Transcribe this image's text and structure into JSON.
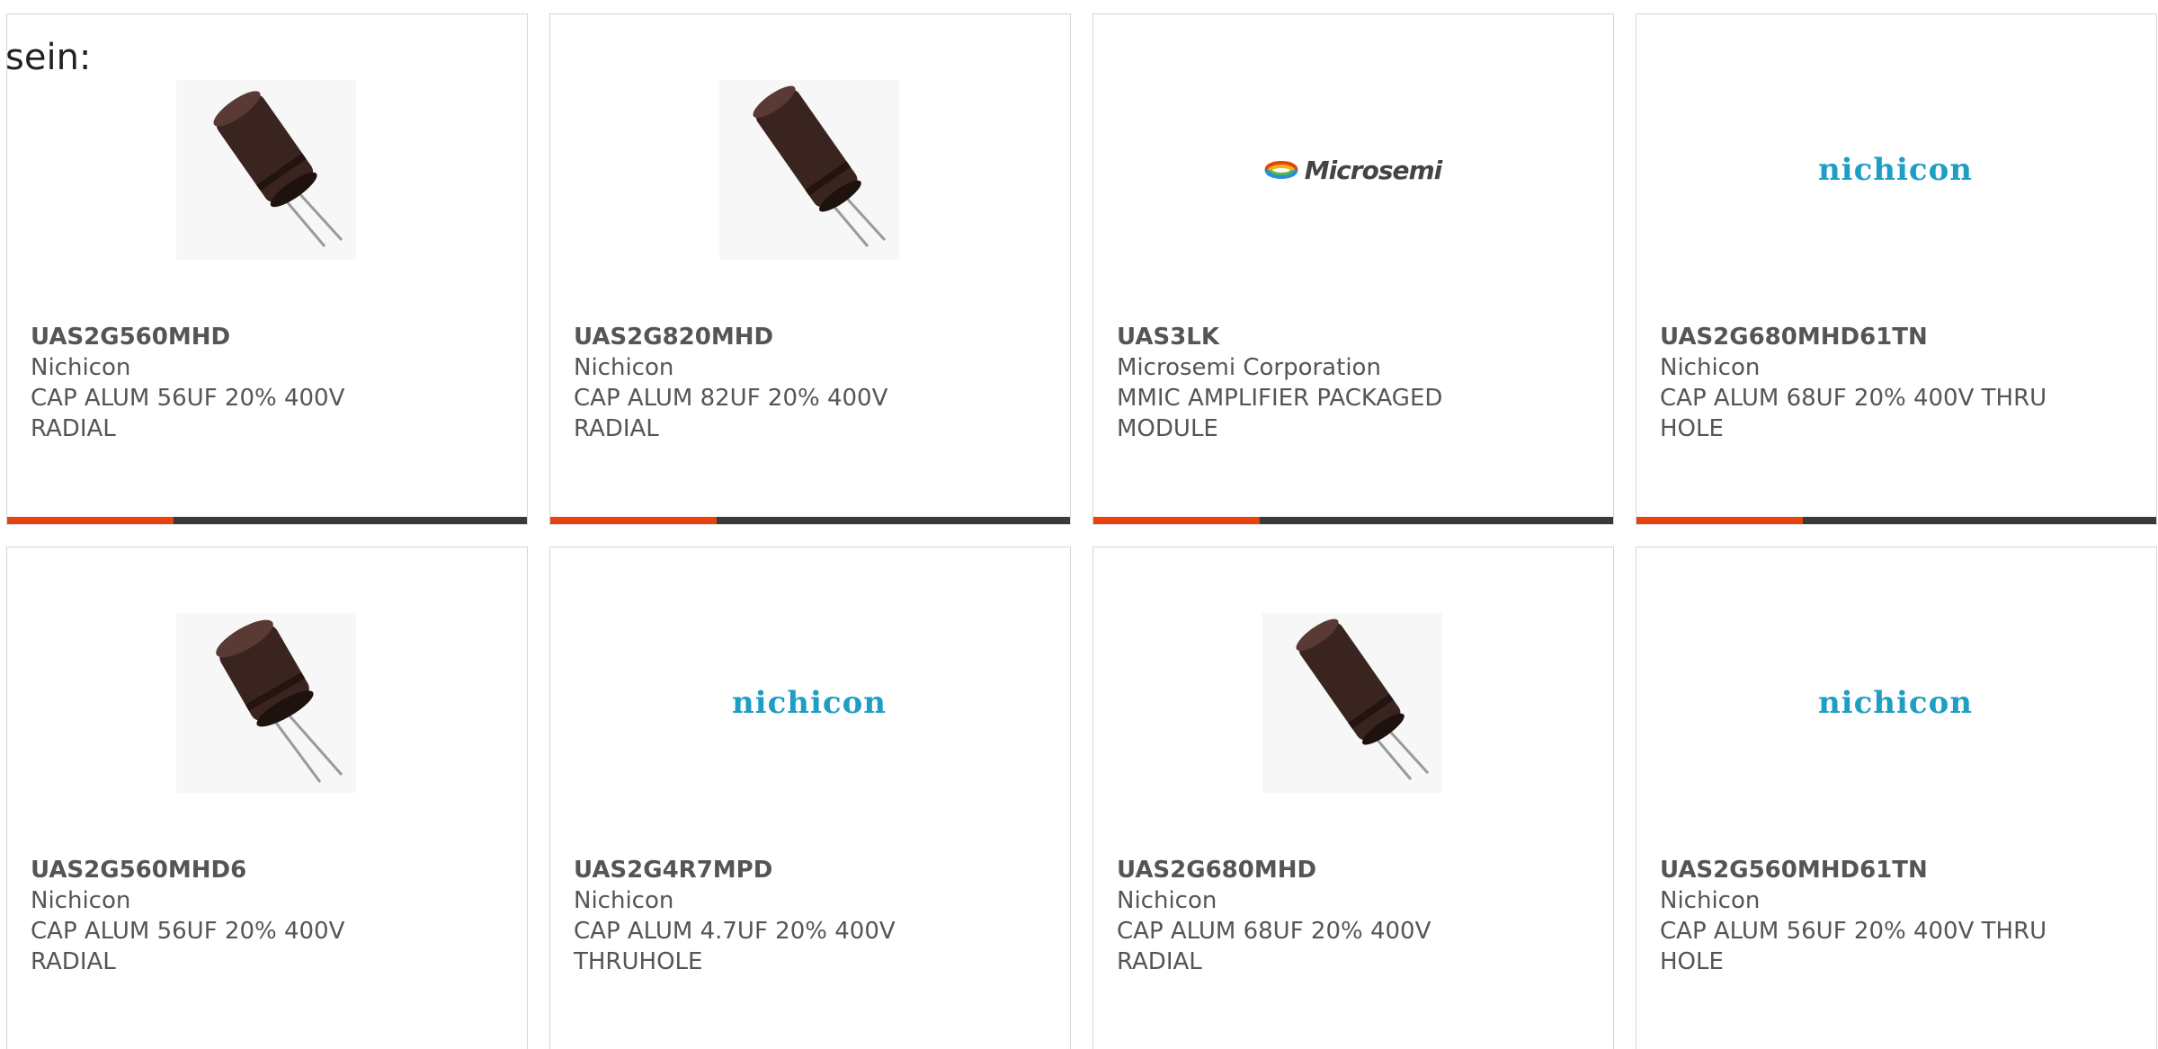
{
  "intro": {
    "text": "sein:"
  },
  "colors": {
    "accent": "#e8420e",
    "bar": "#3a3a3a",
    "nichicon_logo": "#1f9ec4",
    "card_text": "#555555"
  },
  "products": [
    {
      "part_number": "UAS2G560MHD",
      "manufacturer": "Nichicon",
      "description": "CAP ALUM 56UF 20% 400V",
      "description_2": "RADIAL",
      "image": "capacitor-photo",
      "progress": 0.32
    },
    {
      "part_number": "UAS2G820MHD",
      "manufacturer": "Nichicon",
      "description": "CAP ALUM 82UF 20% 400V",
      "description_2": "RADIAL",
      "image": "capacitor-photo",
      "progress": 0.32
    },
    {
      "part_number": "UAS3LK",
      "manufacturer": "Microsemi Corporation",
      "description": "MMIC AMPLIFIER PACKAGED",
      "description_2": "MODULE",
      "image": "microsemi-logo",
      "logo_text": "Microsemi",
      "progress": 0.32
    },
    {
      "part_number": "UAS2G680MHD61TN",
      "manufacturer": "Nichicon",
      "description": "CAP ALUM 68UF 20% 400V THRU",
      "description_2": "HOLE",
      "image": "nichicon-logo",
      "logo_text": "nichicon",
      "progress": 0.32
    },
    {
      "part_number": "UAS2G560MHD6",
      "manufacturer": "Nichicon",
      "description": "CAP ALUM 56UF 20% 400V",
      "description_2": "RADIAL",
      "image": "capacitor-photo"
    },
    {
      "part_number": "UAS2G4R7MPD",
      "manufacturer": "Nichicon",
      "description": "CAP ALUM 4.7UF 20% 400V",
      "description_2": "THRUHOLE",
      "image": "nichicon-logo",
      "logo_text": "nichicon"
    },
    {
      "part_number": "UAS2G680MHD",
      "manufacturer": "Nichicon",
      "description": "CAP ALUM 68UF 20% 400V",
      "description_2": "RADIAL",
      "image": "capacitor-photo"
    },
    {
      "part_number": "UAS2G560MHD61TN",
      "manufacturer": "Nichicon",
      "description": "CAP ALUM 56UF 20% 400V THRU",
      "description_2": "HOLE",
      "image": "nichicon-logo",
      "logo_text": "nichicon"
    }
  ]
}
